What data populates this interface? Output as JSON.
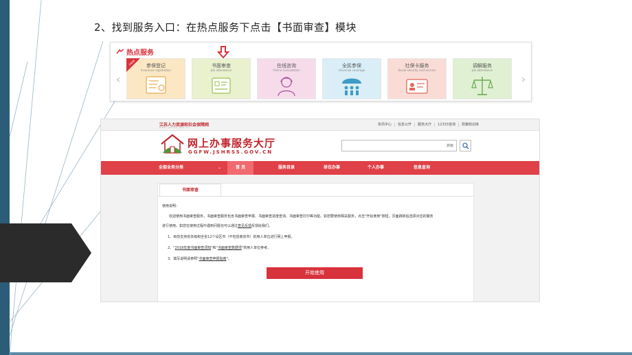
{
  "slide": {
    "title": "2、找到服务入口：在热点服务下点击【书面审查】模块"
  },
  "hot_services": {
    "header": "热点服务",
    "cards": [
      {
        "title": "参保登记",
        "subtitle": "Insurance registration",
        "bg": "#fbe7c4",
        "badge": "new"
      },
      {
        "title": "书面审查",
        "subtitle": "Job attendance",
        "bg": "#e9f1cf"
      },
      {
        "title": "在线咨询",
        "subtitle": "Online Consultation",
        "bg": "#f6dceb"
      },
      {
        "title": "全民参保",
        "subtitle": "Universal coverage",
        "bg": "#d9eef7"
      },
      {
        "title": "社保卡服务",
        "subtitle": "Social security card service",
        "bg": "#f9dcd6"
      },
      {
        "title": "调解服务",
        "subtitle": "Job attendance",
        "bg": "#e0f0d3"
      }
    ],
    "prev_glyph": "‹",
    "next_glyph": "›"
  },
  "site": {
    "provider": "江苏人力资源和社会保障网",
    "provider_url": "www.jshrss.gov.cn",
    "top_links": [
      "资讯中心",
      "信息公开",
      "服务大厅",
      "12333咨询",
      "政策知识库"
    ],
    "brand_name": "网上办事服务大厅",
    "brand_url": "GGFW.JSHRSS.GOV.CN",
    "search_placeholder": "",
    "search_advanced": "高级",
    "nav": {
      "all": "全部业务分类",
      "all_caret": "⌄",
      "home": "首 页",
      "catalog": "服务目录",
      "unit": "单位办事",
      "personal": "个人办事",
      "query": "信息查询"
    },
    "tab_label": "书面审查",
    "usage_title": "使用说明：",
    "para_1": "欢迎使用书面审查服务，书面审查服务包含书面审查申报、书面审查进度查询、书面审查打印等功能。如您要使用相关服务，点击\"开始使用\"按钮，页面跳转后选择对应的服务",
    "para_2_prefix": "进行使用。如您在使用过程中遇到问题也可以通过",
    "para_2_link": "意见反馈",
    "para_2_suffix": "反馈给我们。",
    "item_1": "1、目前支持省本级和全省12个设区市（不包括南京市）的用人单位进行网上申报。",
    "item_2_prefix": "2、\"",
    "item_2_link_1": "2018年度书面审查须知",
    "item_2_mid": "\"和\"",
    "item_2_link_2": "书面审查数据项",
    "item_2_suffix": "\"供用人单位参考。",
    "item_3_prefix": "3、填写说明请参照\"",
    "item_3_link": "书面审查申报指南",
    "item_3_suffix": "\"。",
    "start_button": "开始使用"
  },
  "colors": {
    "slide_bar": "#2b5d78",
    "brand_red": "#c0262d",
    "nav_red": "#e04047",
    "nav_active": "#f06a6f",
    "button_red": "#d8323c"
  }
}
